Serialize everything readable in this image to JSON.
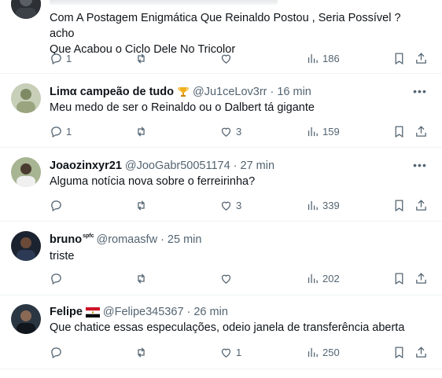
{
  "tweets": [
    {
      "name": "",
      "handle": "",
      "time": "",
      "text_lines": [
        "Com A Postagem Enigmática Que Reinaldo Postou , Seria Possível ? acho",
        "Que Acabou o Ciclo Dele No Tricolor"
      ],
      "replies": "1",
      "retweets": "",
      "likes": "",
      "views": "186",
      "avatar_color": "#2b2f33"
    },
    {
      "name": "Limα campeão de tudo",
      "name_emoji": "trophy-icon",
      "handle": "@Ju1ceLov3rr",
      "sep": "·",
      "time": "16 min",
      "text_lines": [
        "Meu medo de ser o Reinaldo ou o Dalbert tá gigante"
      ],
      "replies": "1",
      "retweets": "",
      "likes": "3",
      "views": "159",
      "avatar_color": "#8a9a6c"
    },
    {
      "name": "Joaozinxyr21",
      "handle": "@JooGabr50051174",
      "sep": "·",
      "time": "27 min",
      "text_lines": [
        "Alguma notícia nova sobre o ferreirinha?"
      ],
      "replies": "",
      "retweets": "",
      "likes": "3",
      "views": "339",
      "avatar_color": "#5d6b4a"
    },
    {
      "name": "bruno",
      "name_badge": "spfc",
      "handle": "@romaasfw",
      "sep": "·",
      "time": "25 min",
      "text_lines": [
        "triste"
      ],
      "replies": "",
      "retweets": "",
      "likes": "",
      "views": "202",
      "avatar_color": "#1f2a3a"
    },
    {
      "name": "Felipe",
      "name_emoji": "flag-icon",
      "handle": "@Felipe345367",
      "sep": "·",
      "time": "26 min",
      "text_lines": [
        "Que chatice essas especulações, odeio janela de transferência aberta"
      ],
      "replies": "",
      "retweets": "",
      "likes": "1",
      "views": "250",
      "avatar_color": "#22303c"
    }
  ],
  "more_label": "•••",
  "colors": {
    "text": "#0f1419",
    "secondary": "#536471",
    "divider": "#eff3f4"
  }
}
